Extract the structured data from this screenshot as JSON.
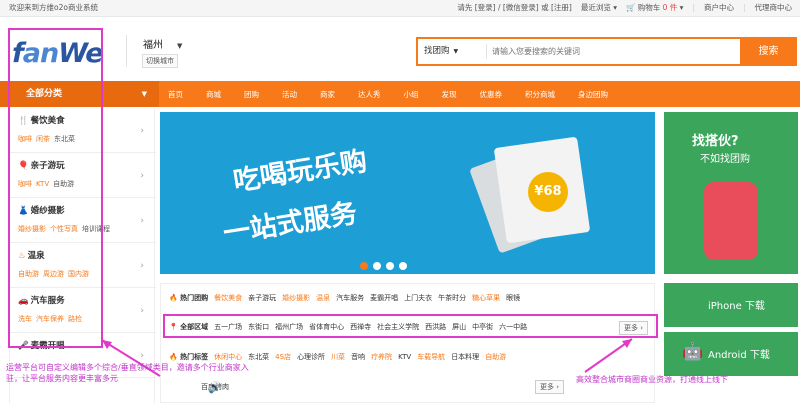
{
  "topbar": {
    "welcome": "欢迎来到方维o2o商业系统",
    "login_prompt": "请先 [登录] / [微信登录] 或 [注册]",
    "recent_browse": "最近浏览",
    "cart": "购物车",
    "cart_count": "0 件",
    "merchant_center": "商户中心",
    "agent_center": "代理商中心"
  },
  "logo": {
    "text_f": "f",
    "text_an": "an",
    "text_we": "We"
  },
  "city": {
    "name": "福州",
    "switch": "切换城市"
  },
  "search": {
    "type": "找团购",
    "placeholder": "请输入您要搜索的关键词",
    "button": "搜索"
  },
  "nav": {
    "all_categories": "全部分类",
    "items": [
      "首页",
      "商城",
      "团购",
      "活动",
      "商家",
      "达人秀",
      "小组",
      "发现",
      "优惠券",
      "积分商城",
      "身边团购"
    ]
  },
  "categories": [
    {
      "title": "餐饮美食",
      "subs": [
        "咖啡",
        "闲茶",
        "东北菜"
      ]
    },
    {
      "title": "亲子游玩",
      "subs": [
        "咖啡",
        "KTV",
        "自助游"
      ]
    },
    {
      "title": "婚纱摄影",
      "subs": [
        "婚纱摄影",
        "个性写真",
        "培训课程"
      ]
    },
    {
      "title": "温泉",
      "subs": [
        "自助游",
        "周边游",
        "国内游"
      ]
    },
    {
      "title": "汽车服务",
      "subs": [
        "洗车",
        "汽车保养",
        "路检"
      ]
    },
    {
      "title": "麦霸开唱",
      "subs": []
    }
  ],
  "banner": {
    "line1": "吃喝玩乐购",
    "line2": "一站式服务",
    "price": "¥68"
  },
  "ad": {
    "line1": "找搭伙?",
    "line2": "不如找团购"
  },
  "app": {
    "iphone": "iPhone 下载",
    "android": "Android 下载"
  },
  "hot": {
    "group_label": "热门团购",
    "group_items": [
      "餐饮美食",
      "亲子游玩",
      "婚纱摄影",
      "温泉",
      "汽车服务",
      "麦霸开唱",
      "上门夫衣",
      "午茶时分",
      "糖心草果",
      "眼镜"
    ],
    "area_label": "全部区域",
    "areas": [
      "五一广场",
      "东街口",
      "福州广场",
      "省体育中心",
      "西禅寺",
      "社会主义学院",
      "西洪路",
      "屏山",
      "中亭街",
      "六一中路"
    ],
    "tag_label": "热门标签",
    "tags": [
      "休闲中心",
      "东北菜",
      "4S店",
      "心理诊所",
      "川菜",
      "音响",
      "疗养院",
      "KTV",
      "车载导航",
      "日本料理",
      "自助游"
    ],
    "more": "更多",
    "notice": "百度烤肉"
  },
  "annotations": {
    "left": "运营平台可自定义编辑多个综合/垂直领域类目，邀请多个行业商家入驻，让平台服务内容更丰富多元",
    "right": "高效整合城市商圈商业资源，打通线上线下"
  }
}
